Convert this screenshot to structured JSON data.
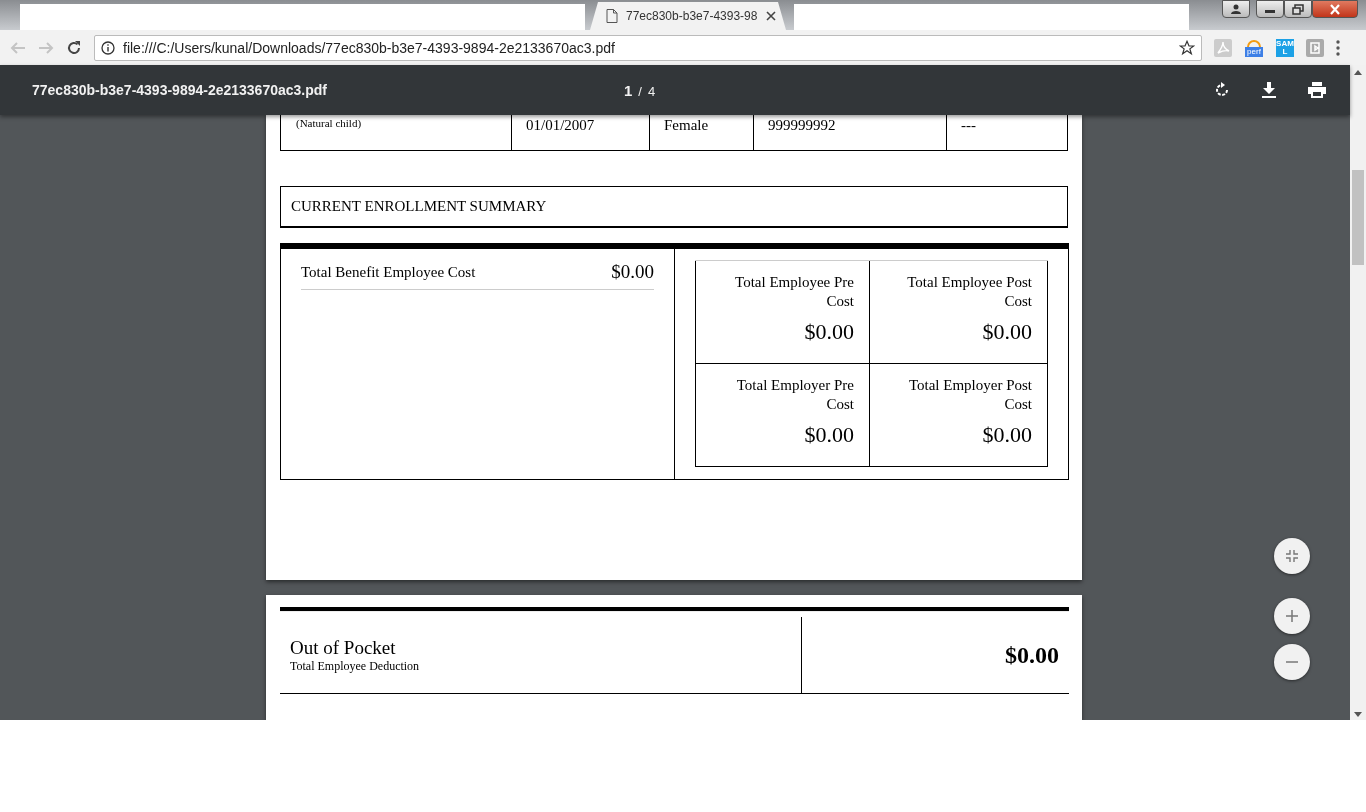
{
  "browser": {
    "tab": {
      "title": "77ec830b-b3e7-4393-98",
      "selected": true
    },
    "address_bar": {
      "url": "file:///C:/Users/kunal/Downloads/77ec830b-b3e7-4393-9894-2e2133670ac3.pdf"
    },
    "extensions": [
      {
        "kind": "pdf"
      },
      {
        "kind": "perf",
        "label": "perf"
      },
      {
        "kind": "saml",
        "label": "SAML"
      },
      {
        "kind": "flag"
      }
    ]
  },
  "pdf_toolbar": {
    "title": "77ec830b-b3e7-4393-9894-2e2133670ac3.pdf",
    "page": "1",
    "separator": "/",
    "page_count": "4"
  },
  "dependent_row": [
    "(Natural child)",
    "01/01/2007",
    "Female",
    "999999992",
    "---"
  ],
  "section_title": "CURRENT ENROLLMENT SUMMARY",
  "total_benefit": {
    "label": "Total Benefit Employee Cost",
    "value": "$0.00"
  },
  "cost_grid": [
    {
      "label": "Total Employee Pre Cost",
      "value": "$0.00"
    },
    {
      "label": "Total Employee Post Cost",
      "value": "$0.00"
    },
    {
      "label": "Total Employer Pre Cost",
      "value": "$0.00"
    },
    {
      "label": "Total Employer Post Cost",
      "value": "$0.00"
    }
  ],
  "out_of_pocket": {
    "title": "Out of Pocket",
    "subtitle": "Total Employee Deduction",
    "value": "$0.00"
  }
}
